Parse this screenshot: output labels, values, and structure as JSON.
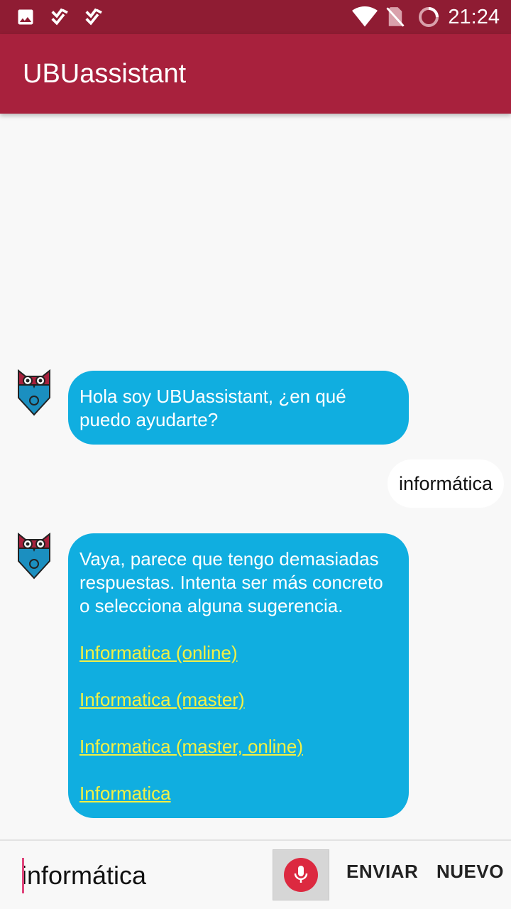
{
  "status_bar": {
    "time": "21:24",
    "icons": [
      "image-icon",
      "checklist-icon",
      "checklist-icon",
      "wifi-icon",
      "no-sim-icon",
      "battery-saver-icon"
    ]
  },
  "app_bar": {
    "title": "UBUassistant"
  },
  "chat": {
    "messages": [
      {
        "from": "bot",
        "text": "Hola soy UBUassistant, ¿en qué puedo ayudarte?"
      },
      {
        "from": "user",
        "text": "informática"
      },
      {
        "from": "bot",
        "text": "Vaya, parece que tengo demasiadas respuestas. Intenta ser más concreto o selecciona alguna sugerencia.",
        "suggestions": [
          "Informatica (online)",
          "Informatica (master)",
          "Informatica (master, online)",
          "Informatica"
        ]
      }
    ]
  },
  "input_bar": {
    "value": "informática",
    "send_label": "ENVIAR",
    "new_label": "NUEVO"
  },
  "colors": {
    "status_bar": "#8f1c33",
    "app_bar": "#a8213d",
    "bot_bubble": "#10aee0",
    "link": "#f3f044",
    "mic": "#dc2940"
  }
}
